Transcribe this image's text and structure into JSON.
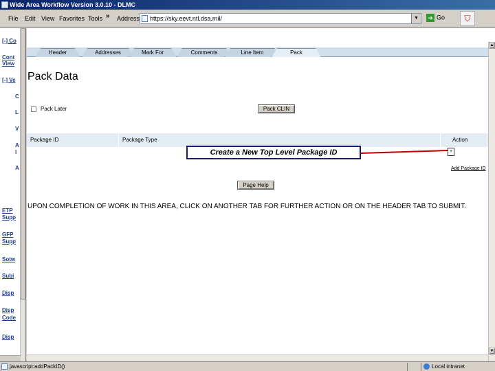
{
  "window": {
    "title": "Wide Area Workflow Version 3.0.10 - DLMC"
  },
  "toolbar": {
    "menus": [
      "File",
      "Edit",
      "View",
      "Favorites",
      "Tools"
    ],
    "chevron": "»",
    "address_label": "Address",
    "address_value": "https://sky.eevt.ntl.dsa.mil/",
    "go_label": "Go"
  },
  "sidebar": {
    "items": [
      "[-] Co",
      "Cont",
      "View",
      "[-] Ve",
      "C",
      "L",
      "V",
      "A",
      "I",
      "A",
      "ETP",
      "Supp",
      "GFP",
      "Supp",
      "Sotw",
      "Subi",
      "Disp",
      "Disp",
      "Code",
      "Disp"
    ]
  },
  "tabs": {
    "items": [
      "Header",
      "Addresses",
      "Mark For",
      "Comments",
      "Line Item",
      "Pack"
    ],
    "active": "Pack"
  },
  "main": {
    "page_title": "Pack Data",
    "pack_later_label": "Pack Later",
    "pack_clin_button": "Pack CLIN",
    "table": {
      "columns": [
        "Package ID",
        "Package Type",
        "Action"
      ]
    },
    "callout": "Create a New Top Level Package ID",
    "add_package_link": "Add Package ID",
    "page_help_button": "Page Help",
    "instructions": "UPON COMPLETION OF WORK IN THIS AREA, CLICK ON ANOTHER TAB FOR FURTHER ACTION OR ON THE HEADER TAB TO SUBMIT."
  },
  "statusbar": {
    "text": "javascript:addPackID()",
    "zone": "Local intranet"
  },
  "colors": {
    "titlebar": "#0a246a",
    "tab_strip": "#cfe0ec",
    "table_header": "#e3ecf4",
    "arrow": "#c00000",
    "sidebar_link": "#1f3c8c"
  }
}
